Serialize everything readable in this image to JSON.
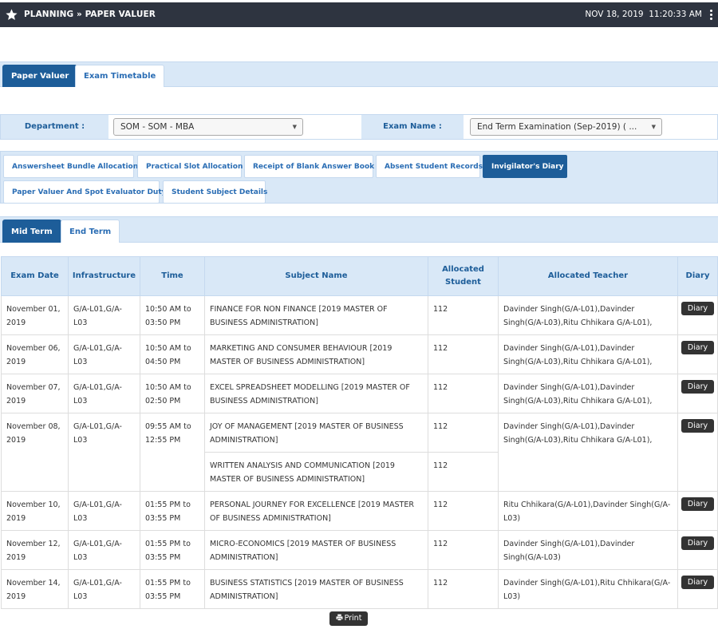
{
  "topbar": {
    "breadcrumb": "PLANNING » PAPER VALUER",
    "datetime": "NOV 18, 2019  11:20:33 AM"
  },
  "main_tabs": [
    "Paper Valuer",
    "Exam Timetable"
  ],
  "filters": {
    "department_label": "Department :",
    "department_value": "SOM - SOM - MBA",
    "exam_label": "Exam Name :",
    "exam_value": "End Term Examination (Sep-2019) ( ..."
  },
  "sub_tabs": [
    "Answersheet Bundle Allocation",
    "Practical Slot Allocation",
    "Receipt of Blank Answer Book",
    "Absent Student Records",
    "Invigilator's Diary",
    "Paper Valuer And Spot Evaluator Duty",
    "Student Subject Details"
  ],
  "term_tabs": [
    "Mid Term",
    "End Term"
  ],
  "table": {
    "headers": [
      "Exam Date",
      "Infrastructure",
      "Time",
      "Subject Name",
      "Allocated Student",
      "Allocated Teacher",
      "Diary"
    ],
    "diary_label": "Diary",
    "rows": [
      {
        "date": "November 01, 2019",
        "infra": "G/A-L01,G/A-L03",
        "time": "10:50 AM to 03:50 PM",
        "subject": "FINANCE FOR NON FINANCE [2019 MASTER OF BUSINESS ADMINISTRATION]",
        "students": "112",
        "teacher": "Davinder Singh(G/A-L01),Davinder Singh(G/A-L03),Ritu Chhikara G/A-L01),"
      },
      {
        "date": "November 06, 2019",
        "infra": "G/A-L01,G/A-L03",
        "time": "10:50 AM to 04:50 PM",
        "subject": "MARKETING AND CONSUMER BEHAVIOUR [2019 MASTER OF BUSINESS ADMINISTRATION]",
        "students": "112",
        "teacher": "Davinder Singh(G/A-L01),Davinder Singh(G/A-L03),Ritu Chhikara G/A-L01),"
      },
      {
        "date": "November 07, 2019",
        "infra": "G/A-L01,G/A-L03",
        "time": "10:50 AM to 02:50 PM",
        "subject": "EXCEL SPREADSHEET MODELLING [2019 MASTER OF BUSINESS ADMINISTRATION]",
        "students": "112",
        "teacher": "Davinder Singh(G/A-L01),Davinder Singh(G/A-L03),Ritu Chhikara G/A-L01),"
      },
      {
        "date": "November 08, 2019",
        "infra": "G/A-L01,G/A-L03",
        "time": "09:55 AM to 12:55 PM",
        "subject": "JOY OF MANAGEMENT [2019 MASTER OF BUSINESS ADMINISTRATION]",
        "students": "112",
        "teacher": "Davinder Singh(G/A-L01),Davinder Singh(G/A-L03),Ritu Chhikara G/A-L01),",
        "extra_subject": "WRITTEN ANALYSIS AND COMMUNICATION [2019 MASTER OF BUSINESS ADMINISTRATION]",
        "extra_students": "112"
      },
      {
        "date": "November 10, 2019",
        "infra": "G/A-L01,G/A-L03",
        "time": "01:55 PM to 03:55 PM",
        "subject": "PERSONAL JOURNEY FOR EXCELLENCE [2019 MASTER OF BUSINESS ADMINISTRATION]",
        "students": "112",
        "teacher": "Ritu Chhikara(G/A-L01),Davinder Singh(G/A-L03)"
      },
      {
        "date": "November 12, 2019",
        "infra": "G/A-L01,G/A-L03",
        "time": "01:55 PM to 03:55 PM",
        "subject": "MICRO-ECONOMICS [2019 MASTER OF BUSINESS ADMINISTRATION]",
        "students": "112",
        "teacher": "Davinder Singh(G/A-L01),Davinder Singh(G/A-L03)"
      },
      {
        "date": "November 14, 2019",
        "infra": "G/A-L01,G/A-L03",
        "time": "01:55 PM to 03:55 PM",
        "subject": "BUSINESS STATISTICS [2019 MASTER OF BUSINESS ADMINISTRATION]",
        "students": "112",
        "teacher": "Davinder Singh(G/A-L01),Ritu Chhikara(G/A-L03)"
      }
    ]
  },
  "print_label": "Print",
  "icons": {
    "star": "star-icon",
    "menu": "kebab-menu-icon",
    "print": "printer-icon"
  },
  "colors": {
    "topbar": "#2e3440",
    "accent": "#1d5d99",
    "tab_bg": "#d9e8f7"
  }
}
